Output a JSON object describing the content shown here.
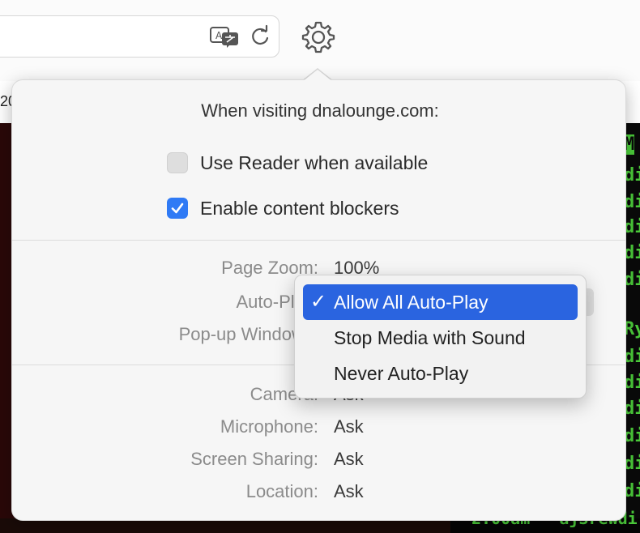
{
  "toolbar": {
    "translate_icon": "translate-icon",
    "reload_icon": "reload-icon",
    "settings_icon": "gear-icon",
    "left_fragment": "20"
  },
  "background_page": {
    "right_fragments": [
      "M",
      "di",
      "di",
      "di",
      "di",
      "di",
      "Ry",
      "di",
      "di",
      "di",
      "di",
      "di",
      "di"
    ],
    "bottom_fragment": "2.00am · aj3rewdi"
  },
  "popover": {
    "title": "When visiting dnalounge.com:",
    "reader": {
      "label": "Use Reader when available",
      "checked": false
    },
    "content_blockers": {
      "label": "Enable content blockers",
      "checked": true
    },
    "settings": [
      {
        "label": "Page Zoom:",
        "value": "100%"
      },
      {
        "label": "Auto-Play:",
        "value": "Allow All Auto-Play"
      },
      {
        "label": "Pop-up Windows:",
        "value": ""
      },
      {
        "label": "Camera:",
        "value": "Ask"
      },
      {
        "label": "Microphone:",
        "value": "Ask"
      },
      {
        "label": "Screen Sharing:",
        "value": "Ask"
      },
      {
        "label": "Location:",
        "value": "Ask"
      }
    ]
  },
  "autoplay_menu": {
    "check_mark": "✓",
    "items": [
      {
        "label": "Allow All Auto-Play",
        "selected": true
      },
      {
        "label": "Stop Media with Sound",
        "selected": false
      },
      {
        "label": "Never Auto-Play",
        "selected": false
      }
    ]
  },
  "colors": {
    "accent": "#2a64e0",
    "checkbox_on": "#2f7af5",
    "popover_bg": "#f6f6f6",
    "label_gray": "#8b8b8b",
    "page_green": "#4ccd3b"
  }
}
